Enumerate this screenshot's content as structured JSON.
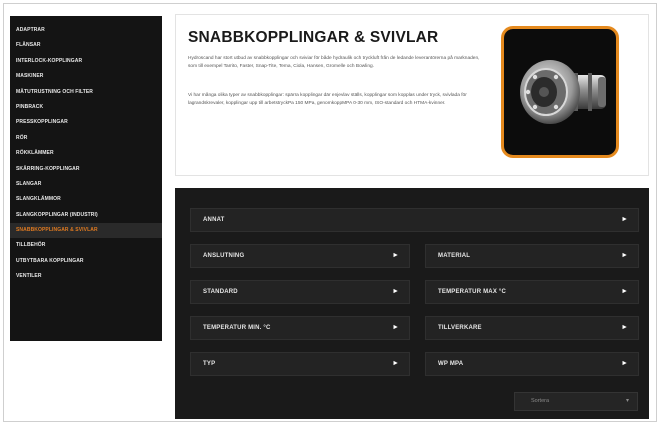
{
  "sidebar": {
    "items": [
      {
        "label": "Adaptrar"
      },
      {
        "label": "Flänsar"
      },
      {
        "label": "Interlock-kopplingar"
      },
      {
        "label": "Maskiner"
      },
      {
        "label": "Mätutrustning och filter"
      },
      {
        "label": "Pinbrack"
      },
      {
        "label": "Presskopplingar"
      },
      {
        "label": "Rör"
      },
      {
        "label": "Rökklämmer"
      },
      {
        "label": "Skärring-kopplingar"
      },
      {
        "label": "Slangar"
      },
      {
        "label": "Slangklämmor"
      },
      {
        "label": "Slangkopplingar (Industri)"
      },
      {
        "label": "Snabbkopplingar & svivlar"
      },
      {
        "label": "Tillbehör"
      },
      {
        "label": "Utbytbara kopplingar"
      },
      {
        "label": "Ventiler"
      }
    ]
  },
  "hero": {
    "title": "SNABBKOPPLINGAR & SVIVLAR",
    "paragraph1": "Hydroscand har stort utbud av snabbkopplingar och sviviar för både hydraulik och tryckluft från de ledande leverantörerna på marknaden, som till exempel Tarrito, Faster, Snap-Tite, Tema, Ciola, Hansen, Gromelle och Bowling.",
    "paragraph2": "Vi har många olika typer av snabbkopplingar: spärra kopplingar där enjevlav ställs, kopplingar som kopplas under tryck, svivlada för lagrandskrevaler, kopplingar upp till arbetstryckPa 150 MPa, genomkoppMPA 0-30 mm, ISO-standard och HTMA-kvinner."
  },
  "filters": [
    {
      "label": "Annat"
    },
    {
      "label": "Anslutning"
    },
    {
      "label": "Material"
    },
    {
      "label": "Standard"
    },
    {
      "label": "Temperatur max °C"
    },
    {
      "label": "Temperatur min. °C"
    },
    {
      "label": "Tillverkare"
    },
    {
      "label": "Typ"
    },
    {
      "label": "WP MPA"
    }
  ],
  "sort": {
    "label": "Sortera"
  },
  "icons": {
    "filter_arrow": "triangle-right",
    "sort_chevron": "chevron-down"
  },
  "colors": {
    "accent": "#e07a20",
    "sidebar_bg": "#141414",
    "panel_bg": "#1a1a1a"
  }
}
